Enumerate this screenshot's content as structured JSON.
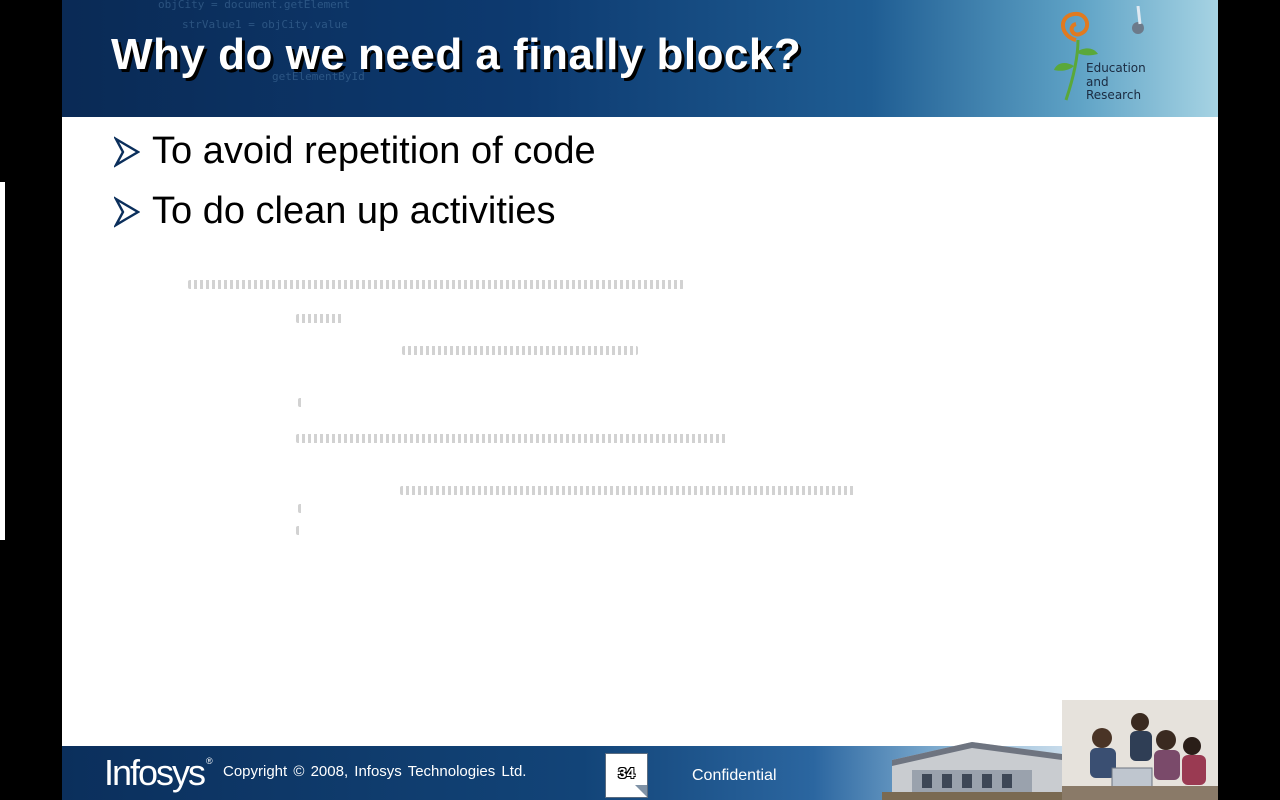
{
  "slide": {
    "title": "Why do we need a finally block?",
    "bullets": [
      "To avoid repetition of code",
      "To do clean up activities"
    ]
  },
  "logo": {
    "lines": [
      "Education",
      "and",
      "Research"
    ]
  },
  "footer": {
    "brand": "Infosys",
    "registered": "®",
    "copyright": "Copyright © 2008, Infosys Technologies Ltd.",
    "page_number": "34",
    "confidential": "Confidential"
  },
  "colors": {
    "header_dark": "#0a2a55",
    "footer_dark": "#0b2f5c",
    "bullet_arrow": "#0b2f5c"
  },
  "icons": {
    "bullet": "arrow-bullet-icon",
    "logo": "education-research-logo"
  }
}
